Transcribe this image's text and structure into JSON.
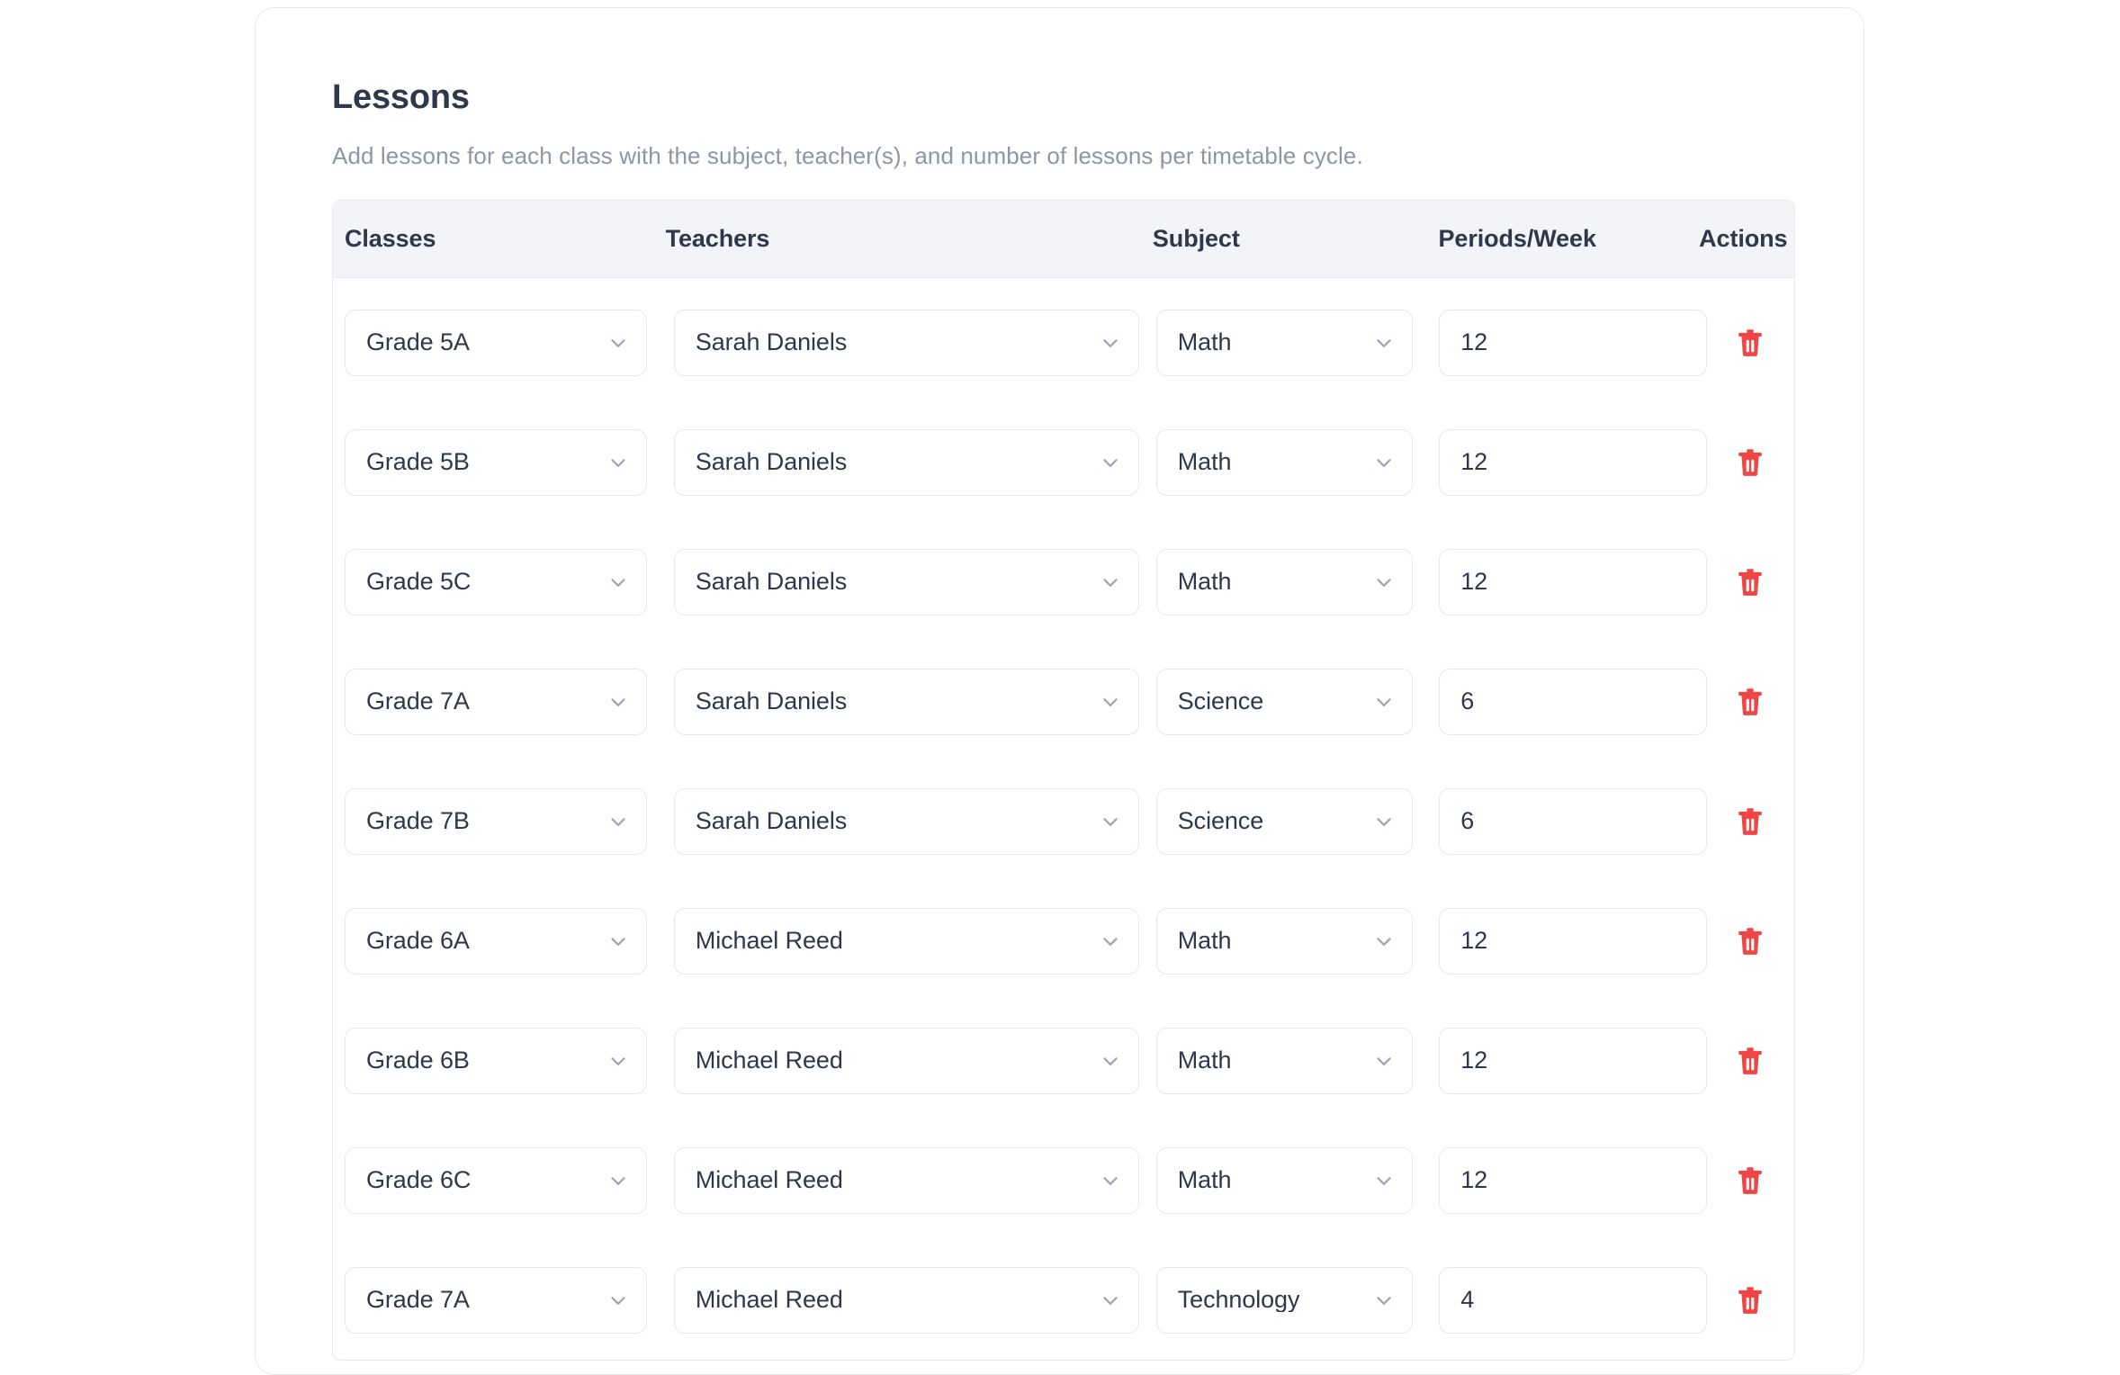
{
  "card": {
    "title": "Lessons",
    "subtitle": "Add lessons for each class with the subject, teacher(s), and number of lessons per timetable cycle."
  },
  "colors": {
    "title": "#2f384a",
    "subtitle": "#8e95a4",
    "header_bg": "#f3f4f7",
    "border": "#e8eaee",
    "input_border": "#e6e8ec",
    "delete_accent": "#f04545",
    "chevron": "#a0a6b3",
    "page_bg": "#ffffff"
  },
  "table": {
    "columns": [
      {
        "key": "classes",
        "label": "Classes"
      },
      {
        "key": "teachers",
        "label": "Teachers"
      },
      {
        "key": "subject",
        "label": "Subject"
      },
      {
        "key": "periods",
        "label": "Periods/Week"
      },
      {
        "key": "actions",
        "label": "Actions"
      }
    ],
    "icons": {
      "select_chevron": "chevron-down-icon",
      "delete": "trash-icon"
    },
    "rows": [
      {
        "classes": "Grade 5A",
        "teachers": "Sarah Daniels",
        "subject": "Math",
        "periods": "12"
      },
      {
        "classes": "Grade 5B",
        "teachers": "Sarah Daniels",
        "subject": "Math",
        "periods": "12"
      },
      {
        "classes": "Grade 5C",
        "teachers": "Sarah Daniels",
        "subject": "Math",
        "periods": "12"
      },
      {
        "classes": "Grade 7A",
        "teachers": "Sarah Daniels",
        "subject": "Science",
        "periods": "6"
      },
      {
        "classes": "Grade 7B",
        "teachers": "Sarah Daniels",
        "subject": "Science",
        "periods": "6"
      },
      {
        "classes": "Grade 6A",
        "teachers": "Michael Reed",
        "subject": "Math",
        "periods": "12"
      },
      {
        "classes": "Grade 6B",
        "teachers": "Michael Reed",
        "subject": "Math",
        "periods": "12"
      },
      {
        "classes": "Grade 6C",
        "teachers": "Michael Reed",
        "subject": "Math",
        "periods": "12"
      },
      {
        "classes": "Grade 7A",
        "teachers": "Michael Reed",
        "subject": "Technology",
        "periods": "4"
      }
    ]
  }
}
